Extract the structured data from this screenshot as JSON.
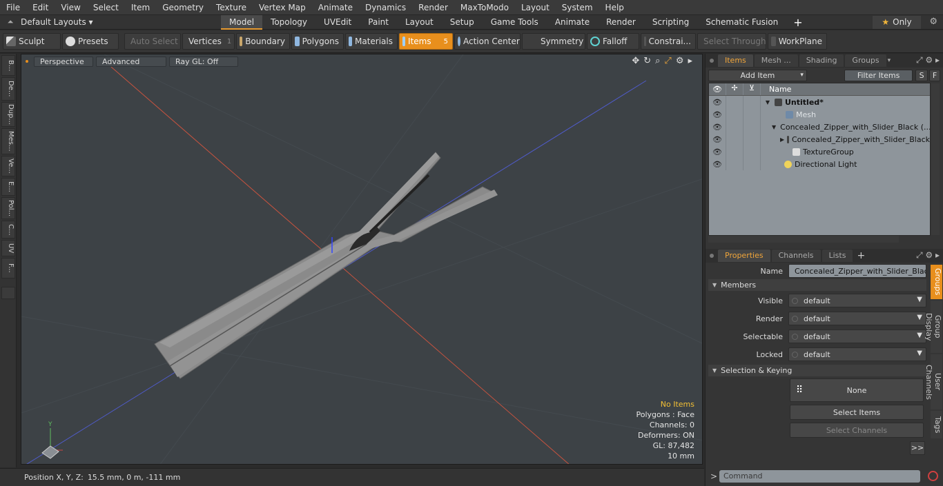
{
  "menu": [
    "File",
    "Edit",
    "View",
    "Select",
    "Item",
    "Geometry",
    "Texture",
    "Vertex Map",
    "Animate",
    "Dynamics",
    "Render",
    "MaxToModo",
    "Layout",
    "System",
    "Help"
  ],
  "layout_dropdown": "Default Layouts",
  "mode_tabs": [
    "Model",
    "Topology",
    "UVEdit",
    "Paint",
    "Layout",
    "Setup",
    "Game Tools",
    "Animate",
    "Render",
    "Scripting",
    "Schematic Fusion"
  ],
  "active_mode_tab": "Model",
  "only_label": "Only",
  "toolbar": {
    "sculpt": "Sculpt",
    "presets": "Presets",
    "auto_select": "Auto Select",
    "vertices": "Vertices",
    "vertices_count": "1",
    "boundary": "Boundary",
    "polygons": "Polygons",
    "materials": "Materials",
    "items": "Items",
    "items_count": "5",
    "action_center": "Action Center",
    "symmetry": "Symmetry",
    "falloff": "Falloff",
    "constraints": "Constrai...",
    "select_through": "Select Through",
    "workplane": "WorkPlane"
  },
  "left_tabs": [
    "B...",
    "De...",
    "Dup...",
    "Mes...",
    "Ve...",
    "E...",
    "Pol...",
    "C...",
    "UV",
    "F..."
  ],
  "viewport": {
    "view": "Perspective",
    "shading": "Advanced",
    "raygl": "Ray GL: Off",
    "info": {
      "no_items": "No Items",
      "polygons": "Polygons : Face",
      "channels": "Channels: 0",
      "deformers": "Deformers: ON",
      "gl": "GL: 87,482",
      "scale": "10 mm"
    },
    "gizmo_y": "Y"
  },
  "status": {
    "label": "Position X, Y, Z:",
    "value": "15.5 mm, 0 m, -111 mm"
  },
  "items_panel": {
    "tabs": [
      "Items",
      "Mesh ...",
      "Shading",
      "Groups"
    ],
    "add_item": "Add Item",
    "filter_items": "Filter Items",
    "s_btn": "S",
    "f_btn": "F",
    "column_name": "Name",
    "rows": [
      {
        "label": "Untitled*",
        "bold": true
      },
      {
        "label": "Mesh",
        "dim": true
      },
      {
        "label": "Concealed_Zipper_with_Slider_Black (..."
      },
      {
        "label": "Concealed_Zipper_with_Slider_Black"
      },
      {
        "label": "TextureGroup"
      },
      {
        "label": "Directional Light"
      }
    ]
  },
  "properties_panel": {
    "tabs": [
      "Properties",
      "Channels",
      "Lists"
    ],
    "name_label": "Name",
    "name_value": "Concealed_Zipper_with_Slider_Black (",
    "members_section": "Members",
    "fields": [
      {
        "label": "Visible",
        "value": "default"
      },
      {
        "label": "Render",
        "value": "default"
      },
      {
        "label": "Selectable",
        "value": "default"
      },
      {
        "label": "Locked",
        "value": "default"
      }
    ],
    "selection_section": "Selection & Keying",
    "none_btn": "None",
    "select_items_btn": "Select Items",
    "select_channels_btn": "Select Channels",
    "more_btn": ">>",
    "side_tabs": [
      "Groups",
      "Group Display",
      "User Channels",
      "Tags"
    ]
  },
  "command_prompt": ">",
  "command_placeholder": "Command"
}
